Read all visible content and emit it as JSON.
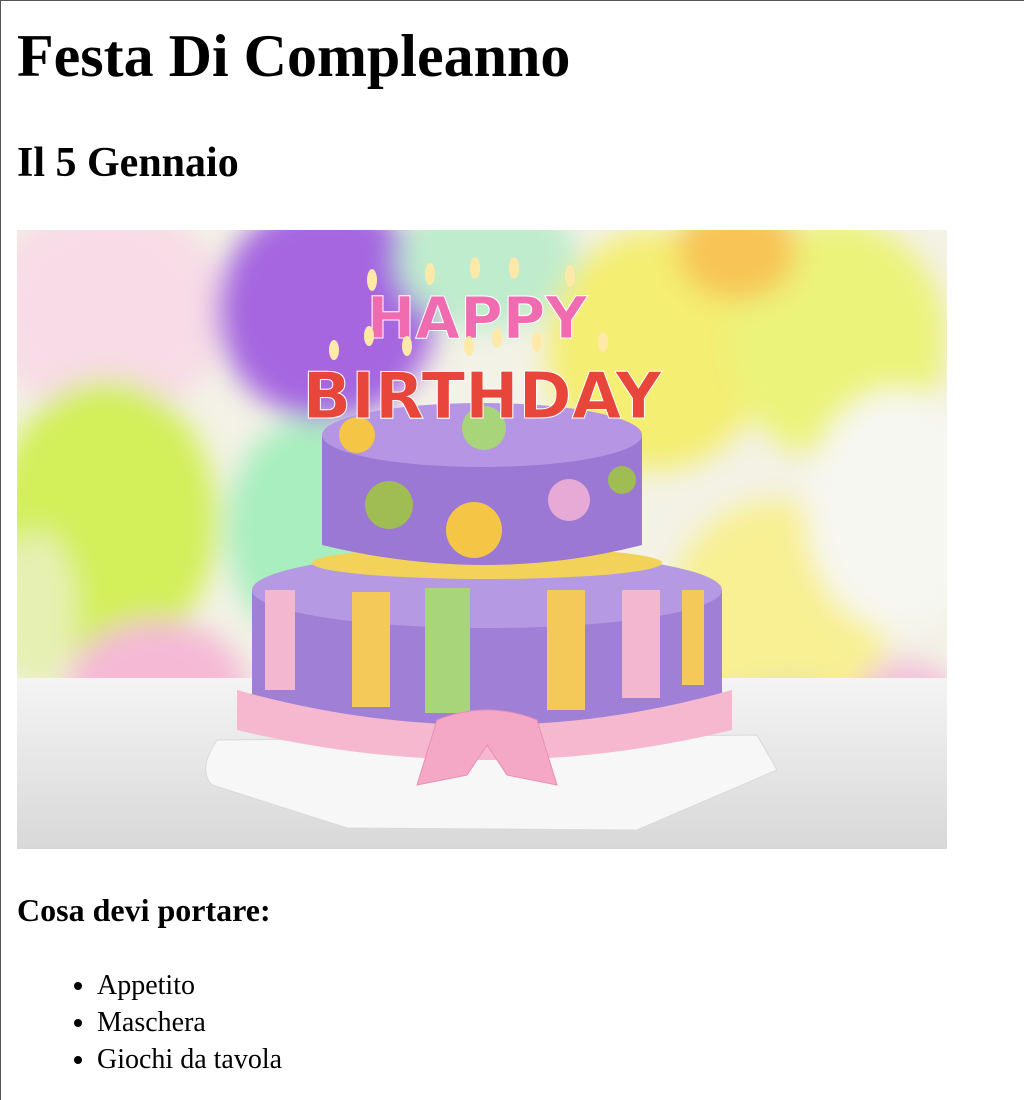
{
  "page": {
    "title": "Festa Di Compleanno",
    "date": "Il 5 Gennaio",
    "image_text": {
      "line1": "HAPPY",
      "line2": "BIRTHDAY"
    },
    "bring_heading": "Cosa devi portare:",
    "bring_items": [
      "Appetito",
      "Maschera",
      "Giochi da tavola"
    ]
  }
}
